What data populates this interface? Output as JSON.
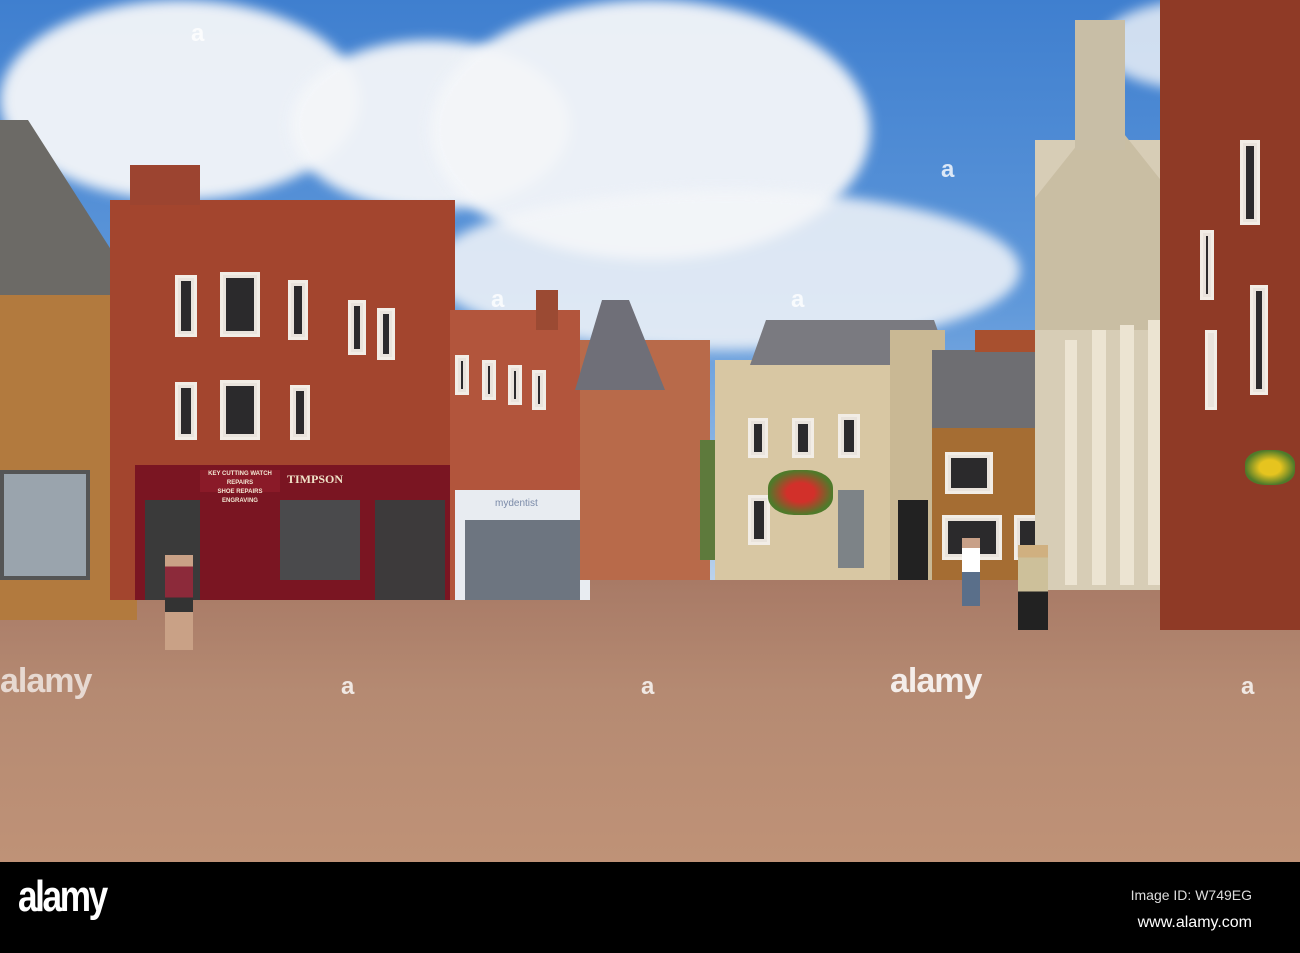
{
  "photo": {
    "shop_signs": {
      "timpson": "TIMPSON",
      "timpson_services_1": "KEY CUTTING  WATCH REPAIRS",
      "timpson_services_2": "SHOE REPAIRS  ENGRAVING",
      "dentist": "mydentist"
    },
    "watermarks": {
      "center": "alamy",
      "small": "a"
    },
    "colors": {
      "sky": "#5f98da",
      "brick": "#a3452e",
      "stone": "#d8c7a3",
      "pavement": "#b58a72",
      "shopfront": "#7a1522"
    }
  },
  "footer": {
    "logo": "alamy",
    "image_id": "Image ID: W749EG",
    "website": "www.alamy.com"
  }
}
